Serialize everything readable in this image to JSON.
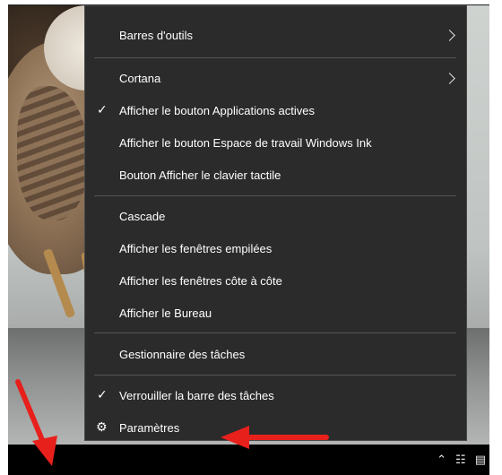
{
  "context_menu": {
    "items": [
      {
        "label": "Barres d'outils",
        "submenu": true
      },
      {
        "label": "Cortana",
        "submenu": true
      },
      {
        "label": "Afficher le bouton Applications actives",
        "checked": true
      },
      {
        "label": "Afficher le bouton Espace de travail Windows Ink"
      },
      {
        "label": "Bouton Afficher le clavier tactile"
      },
      {
        "label": "Cascade"
      },
      {
        "label": "Afficher les fenêtres empilées"
      },
      {
        "label": "Afficher les fenêtres côte à côte"
      },
      {
        "label": "Afficher le Bureau"
      },
      {
        "label": "Gestionnaire des tâches"
      },
      {
        "label": "Verrouiller la barre des tâches",
        "checked": true
      },
      {
        "label": "Paramètres",
        "icon": "gear-icon"
      }
    ]
  },
  "taskbar": {
    "tray_icons": [
      "chevron-up-icon",
      "network-icon",
      "notification-icon"
    ]
  },
  "colors": {
    "menu_bg": "#2b2b2b",
    "menu_text": "#ffffff",
    "annotation": "#e8201c"
  }
}
